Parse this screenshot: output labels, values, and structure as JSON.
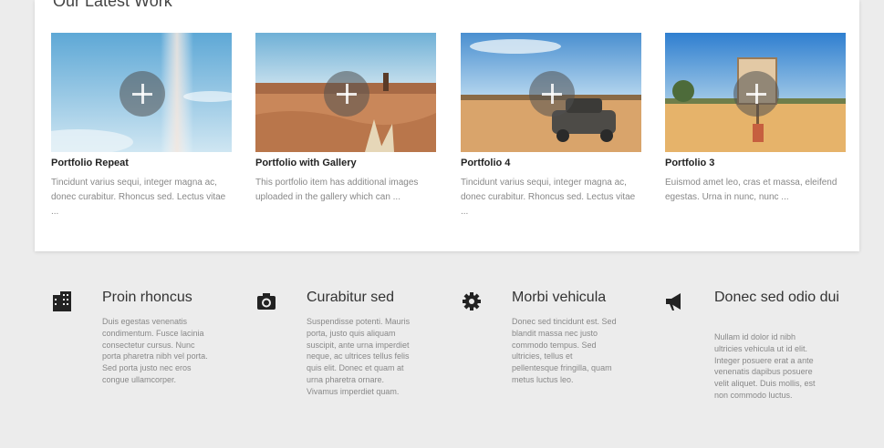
{
  "section": {
    "title": "Our Latest Work"
  },
  "portfolio": [
    {
      "title": "Portfolio Repeat",
      "text": "Tincidunt varius sequi, integer magna ac, donec curabitur. Rhoncus sed. Lectus vitae ...",
      "thumb_icon": "plus-icon"
    },
    {
      "title": "Portfolio with Gallery",
      "text": "This portfolio item has additional images uploaded in the gallery which can ...",
      "thumb_icon": "plus-icon"
    },
    {
      "title": "Portfolio 4",
      "text": "Tincidunt varius sequi, integer magna ac, donec curabitur. Rhoncus sed. Lectus vitae ...",
      "thumb_icon": "plus-icon"
    },
    {
      "title": "Portfolio 3",
      "text": "Euismod amet leo, cras et massa, eleifend egestas. Urna in nunc, nunc ...",
      "thumb_icon": "plus-icon"
    }
  ],
  "features": [
    {
      "title": "Proin rhoncus",
      "text": "Duis egestas venenatis condimentum. Fusce lacinia consectetur cursus. Nunc porta pharetra nibh vel porta. Sed porta justo nec eros congue ullamcorper.",
      "icon": "building-icon"
    },
    {
      "title": "Curabitur sed",
      "text": "Suspendisse potenti. Mauris porta, justo quis aliquam suscipit, ante urna imperdiet neque, ac ultrices tellus felis quis elit. Donec et quam at urna pharetra ornare. Vivamus imperdiet quam.",
      "icon": "camera-icon"
    },
    {
      "title": "Morbi vehicula",
      "text": "Donec sed tincidunt est. Sed blandit massa nec justo commodo tempus. Sed ultricies, tellus et pellentesque fringilla, quam metus luctus leo.",
      "icon": "gear-icon"
    },
    {
      "title": "Donec sed odio dui",
      "text": "Nullam id dolor id nibh ultricies vehicula ut id elit. Integer posuere erat a ante venenatis dapibus posuere velit aliquet. Duis mollis, est non commodo luctus.",
      "icon": "megaphone-icon"
    }
  ]
}
